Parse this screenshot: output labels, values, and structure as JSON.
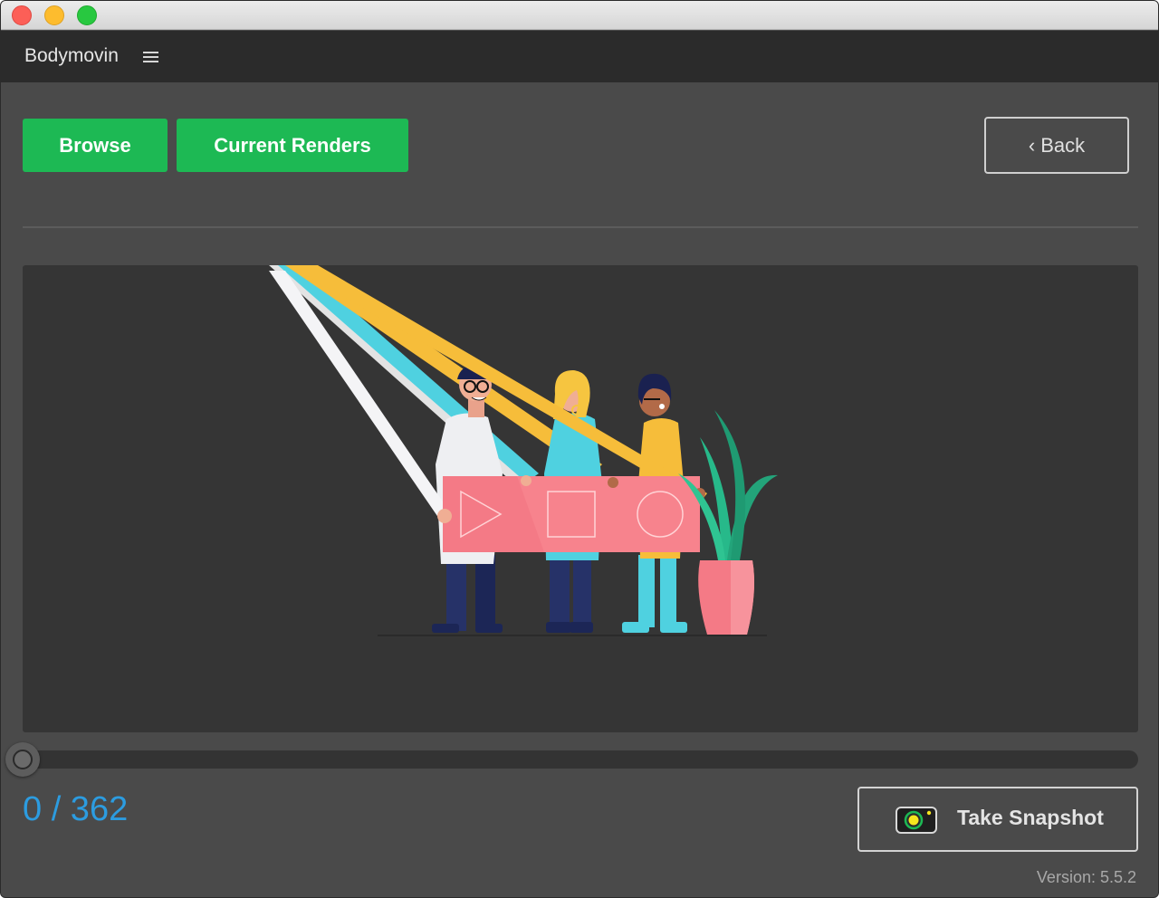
{
  "window": {
    "traffic_lights": [
      "close",
      "minimize",
      "maximize"
    ]
  },
  "header": {
    "app_title": "Bodymovin",
    "menu_icon": "hamburger-menu-icon"
  },
  "toolbar": {
    "browse_label": "Browse",
    "current_renders_label": "Current Renders",
    "back_label": "‹ Back"
  },
  "preview": {
    "illustration": "three people holding a pink media-controls banner next to a potted plant"
  },
  "timeline": {
    "current_frame": 0,
    "total_frames": 362,
    "counter_text": "0 / 362"
  },
  "snapshot": {
    "label": "Take Snapshot",
    "icon": "camera-icon"
  },
  "footer": {
    "version_text": "Version: 5.5.2"
  },
  "colors": {
    "accent_green": "#1db954",
    "counter_blue": "#2c9ce0",
    "background": "#4a4a4a",
    "header": "#2b2b2b",
    "preview_bg": "#353535"
  }
}
